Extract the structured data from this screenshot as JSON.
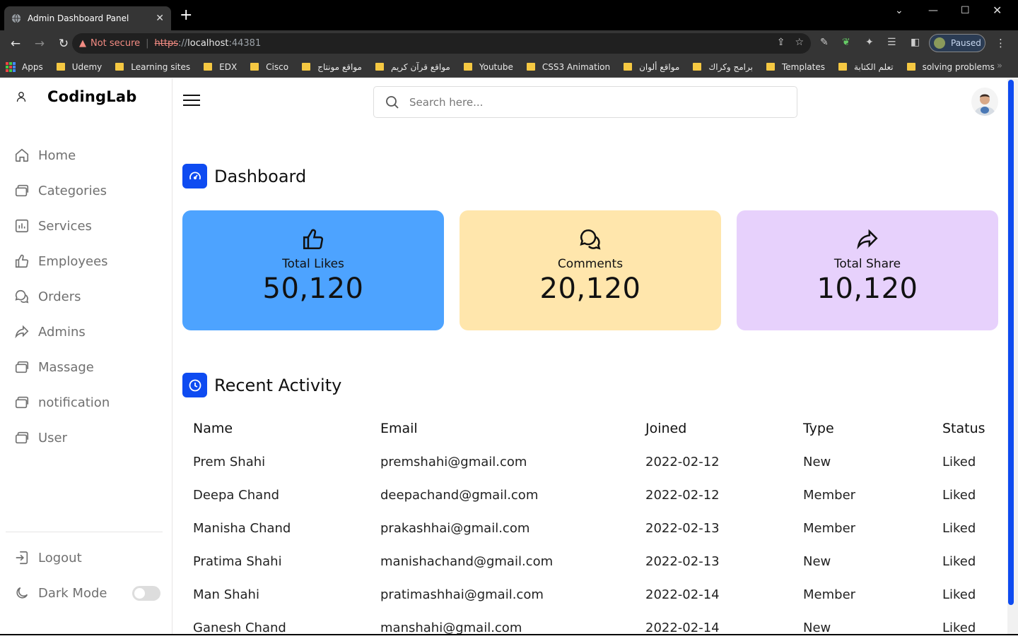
{
  "browser": {
    "tab_title": "Admin Dashboard Panel",
    "close_tab": "✕",
    "new_tab": "+",
    "not_secure": "Not secure",
    "url_scheme": "https",
    "url_sep": "://",
    "url_host": "localhost",
    "url_port": ":44381",
    "profile_status": "Paused",
    "bookmarks": [
      "Apps",
      "Udemy",
      "Learning sites",
      "EDX",
      "Cisco",
      "مواقع مونتاج",
      "مواقع قرآن كريم",
      "Youtube",
      "CSS3 Animation",
      "مواقع ألوان",
      "برامج وكراك",
      "Templates",
      "تعلم الكتابة",
      "solving problems"
    ]
  },
  "sidebar": {
    "logo_text": "CodingLab",
    "items": [
      {
        "label": "Home",
        "icon": "home-icon"
      },
      {
        "label": "Categories",
        "icon": "files-icon"
      },
      {
        "label": "Services",
        "icon": "chart-icon"
      },
      {
        "label": "Employees",
        "icon": "thumbs-up-icon"
      },
      {
        "label": "Orders",
        "icon": "comments-icon"
      },
      {
        "label": "Admins",
        "icon": "share-icon"
      },
      {
        "label": "Massage",
        "icon": "files-icon"
      },
      {
        "label": "notification",
        "icon": "files-icon"
      },
      {
        "label": "User",
        "icon": "files-icon"
      }
    ],
    "logout": "Logout",
    "dark_mode": "Dark Mode"
  },
  "topbar": {
    "search_placeholder": "Search here..."
  },
  "dashboard": {
    "title": "Dashboard",
    "cards": [
      {
        "label": "Total Likes",
        "value": "50,120",
        "color": "#4da3ff"
      },
      {
        "label": "Comments",
        "value": "20,120",
        "color": "#ffe6ac"
      },
      {
        "label": "Total Share",
        "value": "10,120",
        "color": "#e7d1fc"
      }
    ]
  },
  "activity": {
    "title": "Recent Activity",
    "headers": {
      "name": "Name",
      "email": "Email",
      "joined": "Joined",
      "type": "Type",
      "status": "Status"
    },
    "rows": [
      {
        "name": "Prem Shahi",
        "email": "premshahi@gmail.com",
        "joined": "2022-02-12",
        "type": "New",
        "status": "Liked"
      },
      {
        "name": "Deepa Chand",
        "email": "deepachand@gmail.com",
        "joined": "2022-02-12",
        "type": "Member",
        "status": "Liked"
      },
      {
        "name": "Manisha Chand",
        "email": "prakashhai@gmail.com",
        "joined": "2022-02-13",
        "type": "Member",
        "status": "Liked"
      },
      {
        "name": "Pratima Shahi",
        "email": "manishachand@gmail.com",
        "joined": "2022-02-13",
        "type": "New",
        "status": "Liked"
      },
      {
        "name": "Man Shahi",
        "email": "pratimashhai@gmail.com",
        "joined": "2022-02-14",
        "type": "Member",
        "status": "Liked"
      },
      {
        "name": "Ganesh Chand",
        "email": "manshahi@gmail.com",
        "joined": "2022-02-14",
        "type": "New",
        "status": "Liked"
      }
    ]
  },
  "colors": {
    "accent": "#0e4bf1",
    "text_muted": "#707070"
  }
}
